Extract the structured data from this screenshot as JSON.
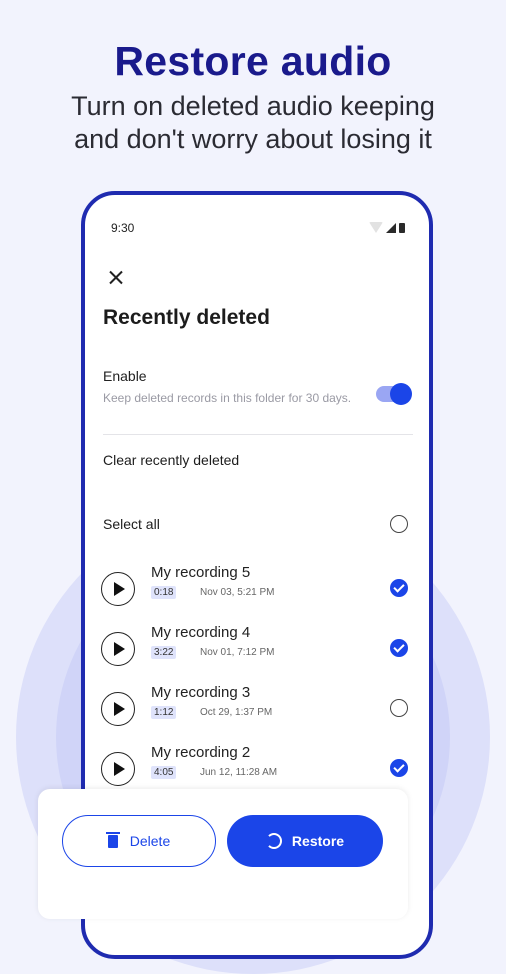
{
  "hero": {
    "title": "Restore audio",
    "subtitle_line1": "Turn on deleted audio keeping",
    "subtitle_line2": "and don't worry about losing it"
  },
  "status_bar": {
    "time": "9:30"
  },
  "screen": {
    "title": "Recently deleted",
    "enable": {
      "label": "Enable",
      "description": "Keep deleted records in this folder for 30 days.",
      "on": true
    },
    "clear_label": "Clear recently deleted",
    "select_all_label": "Select all",
    "recordings": [
      {
        "name": "My recording 5",
        "duration": "0:18",
        "date": "Nov 03, 5:21 PM",
        "selected": true
      },
      {
        "name": "My recording 4",
        "duration": "3:22",
        "date": "Nov 01, 7:12 PM",
        "selected": true
      },
      {
        "name": "My recording 3",
        "duration": "1:12",
        "date": "Oct 29, 1:37 PM",
        "selected": false
      },
      {
        "name": "My recording 2",
        "duration": "4:05",
        "date": "Jun 12, 11:28 AM",
        "selected": true
      }
    ]
  },
  "actions": {
    "delete_label": "Delete",
    "restore_label": "Restore"
  },
  "colors": {
    "accent": "#1b45e8",
    "frame": "#1f2bb0",
    "hero_title": "#1a1a8c"
  },
  "icons": [
    "close-icon",
    "play-icon",
    "trash-icon",
    "restore-icon",
    "wifi-icon",
    "signal-icon",
    "battery-icon"
  ]
}
